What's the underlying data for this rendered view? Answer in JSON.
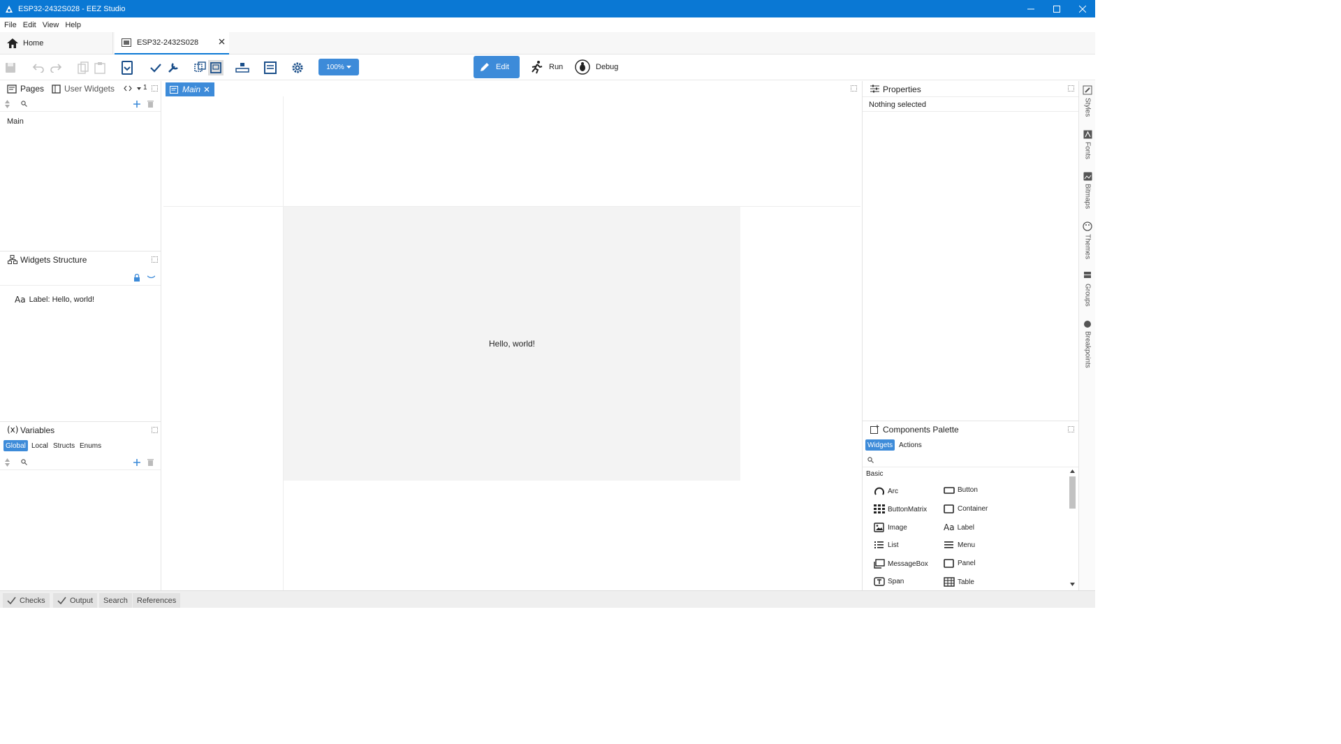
{
  "window": {
    "title": "ESP32-2432S028 - EEZ Studio"
  },
  "menu": [
    "File",
    "Edit",
    "View",
    "Help"
  ],
  "tabs": {
    "home": "Home",
    "project": "ESP32-2432S028"
  },
  "toolbar": {
    "zoom": "100%",
    "edit": "Edit",
    "run": "Run",
    "debug": "Debug"
  },
  "pages_panel": {
    "tab_pages": "Pages",
    "tab_user_widgets": "User Widgets",
    "page_count": "1",
    "items": [
      "Main"
    ]
  },
  "widgets_structure": {
    "title": "Widgets Structure",
    "items": [
      "Label: Hello, world!"
    ]
  },
  "variables": {
    "title": "Variables",
    "tabs": [
      "Global",
      "Local",
      "Structs",
      "Enums"
    ]
  },
  "editor": {
    "tab": "Main",
    "label_text": "Hello, world!"
  },
  "properties": {
    "title": "Properties",
    "status": "Nothing selected"
  },
  "side_tabs": [
    "Styles",
    "Fonts",
    "Bitmaps",
    "Themes",
    "Groups",
    "Breakpoints"
  ],
  "palette": {
    "title": "Components Palette",
    "tabs": [
      "Widgets",
      "Actions"
    ],
    "section": "Basic",
    "items": [
      "Arc",
      "Button",
      "ButtonMatrix",
      "Container",
      "Image",
      "Label",
      "List",
      "Menu",
      "MessageBox",
      "Panel",
      "Span",
      "Table"
    ]
  },
  "bottom_tabs": [
    "Checks",
    "Output",
    "Search",
    "References"
  ],
  "colors": {
    "accent": "#3d8bd9",
    "titlebar": "#0a78d4"
  }
}
